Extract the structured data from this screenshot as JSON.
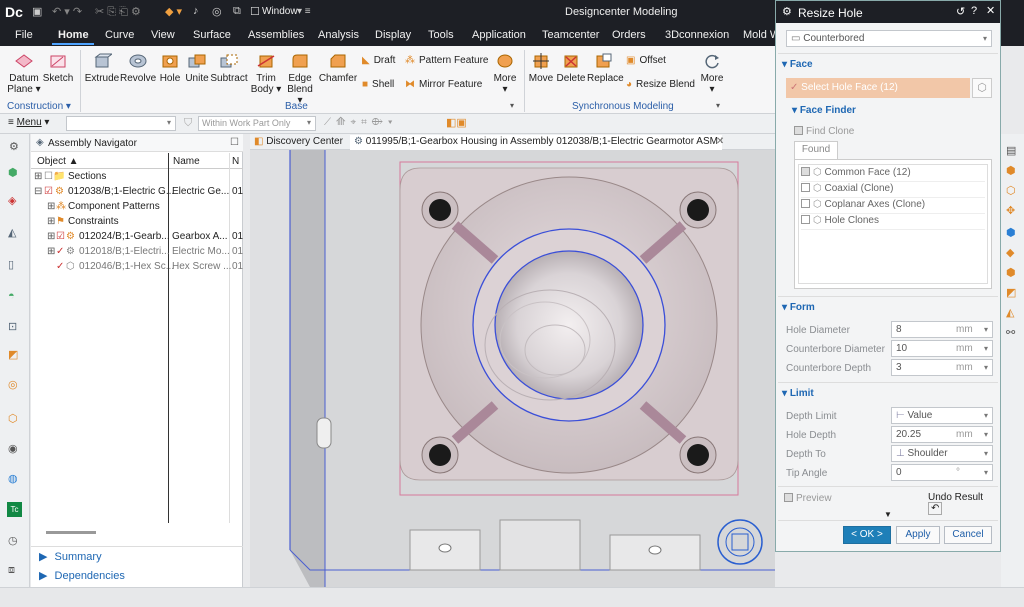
{
  "app": {
    "logo": "Dc",
    "title": "Designcenter Modeling",
    "window_menu": "Window"
  },
  "menu": {
    "items": [
      "File",
      "Home",
      "Curve",
      "View",
      "Surface",
      "Assemblies",
      "Analysis",
      "Display",
      "Tools",
      "Application",
      "Teamcenter",
      "Orders",
      "3Dconnexion",
      "Mold W"
    ]
  },
  "ribbon": {
    "datum_plane": "Datum Plane",
    "sketch": "Sketch",
    "construction": "Construction",
    "extrude": "Extrude",
    "revolve": "Revolve",
    "hole": "Hole",
    "unite": "Unite",
    "subtract": "Subtract",
    "trim_body": "Trim Body",
    "edge_blend": "Edge Blend",
    "chamfer": "Chamfer",
    "draft": "Draft",
    "pattern_feature": "Pattern Feature",
    "shell": "Shell",
    "mirror_feature": "Mirror Feature",
    "more": "More",
    "base": "Base",
    "move": "Move",
    "delete": "Delete",
    "replace": "Replace",
    "offset": "Offset",
    "resize_blend": "Resize Blend",
    "more2": "More",
    "synchronous": "Synchronous Modeling"
  },
  "toolbar2": {
    "menu": "Menu",
    "scope": "Within Work Part Only"
  },
  "navigator": {
    "title": "Assembly Navigator",
    "col_object": "Object",
    "col_name": "Name",
    "col_n": "N",
    "rows": [
      {
        "obj": "Sections",
        "name": "",
        "n": ""
      },
      {
        "obj": "012038/B;1-Electric G...",
        "name": "Electric Ge...",
        "n": "01"
      },
      {
        "obj": "Component Patterns",
        "name": "",
        "n": ""
      },
      {
        "obj": "Constraints",
        "name": "",
        "n": ""
      },
      {
        "obj": "012024/B;1-Gearb...",
        "name": "Gearbox A...",
        "n": "01"
      },
      {
        "obj": "012018/B;1-Electri...",
        "name": "Electric Mo...",
        "n": "01"
      },
      {
        "obj": "012046/B;1-Hex Sc...",
        "name": "Hex Screw ...",
        "n": "01"
      }
    ],
    "summary": "Summary",
    "dependencies": "Dependencies"
  },
  "tabs": {
    "discovery": "Discovery Center",
    "active": "011995/B;1-Gearbox Housing in Assembly 012038/B;1-Electric Gearmotor ASM"
  },
  "dialog": {
    "title": "Resize Hole",
    "type": "Counterbored",
    "face_section": "Face",
    "select_face": "Select Hole Face (12)",
    "face_finder": "Face Finder",
    "find_clone": "Find Clone",
    "found": "Found",
    "finder_items": [
      "Common Face (12)",
      "Coaxial (Clone)",
      "Coplanar Axes (Clone)",
      "Hole Clones"
    ],
    "form_section": "Form",
    "hole_diameter_lbl": "Hole Diameter",
    "hole_diameter": "8",
    "cb_diameter_lbl": "Counterbore Diameter",
    "cb_diameter": "10",
    "cb_depth_lbl": "Counterbore Depth",
    "cb_depth": "3",
    "unit": "mm",
    "limit_section": "Limit",
    "depth_limit_lbl": "Depth Limit",
    "depth_limit": "Value",
    "hole_depth_lbl": "Hole Depth",
    "hole_depth": "20.25",
    "depth_to_lbl": "Depth To",
    "depth_to": "Shoulder",
    "tip_angle_lbl": "Tip Angle",
    "tip_angle": "0",
    "deg": "°",
    "preview": "Preview",
    "undo_result": "Undo Result",
    "ok": "< OK >",
    "apply": "Apply",
    "cancel": "Cancel"
  },
  "colors": {
    "accent": "#1e67b3",
    "dark": "#1d1f25",
    "selection": "#f2c7a8"
  }
}
